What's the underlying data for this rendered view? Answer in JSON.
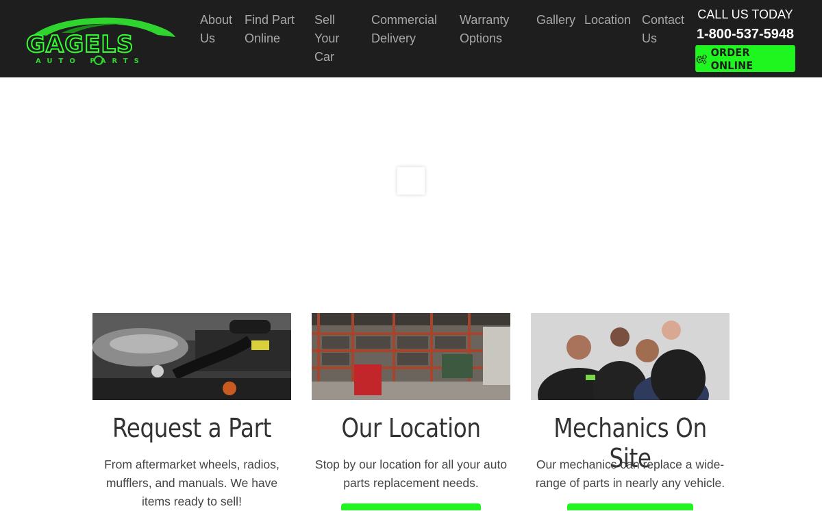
{
  "brand": {
    "logo_word": "GAGELS",
    "logo_sub": "AUTO PARTS",
    "accent": "#1ff61f",
    "header_bg": "#1e1e1e"
  },
  "nav": {
    "items": [
      {
        "label_lines": [
          "About",
          "Us"
        ]
      },
      {
        "label_lines": [
          "Find Part",
          "Online"
        ]
      },
      {
        "label_lines": [
          "Sell",
          "Your",
          "Car"
        ]
      },
      {
        "label_lines": [
          "Commercial",
          "Delivery"
        ]
      },
      {
        "label_lines": [
          "Warranty",
          "Options"
        ]
      },
      {
        "label_lines": [
          "Gallery"
        ]
      },
      {
        "label_lines": [
          "Location"
        ]
      },
      {
        "label_lines": [
          "Contact",
          "Us"
        ]
      }
    ]
  },
  "contact": {
    "call_label": "CALL US TODAY",
    "phone": "1-800-537-5948",
    "order_label": "ORDER ONLINE",
    "order_icon": "gears-icon"
  },
  "cards": [
    {
      "title": "Request a Part",
      "text": "From aftermarket wheels, radios, mufflers, and manuals. We have items ready to sell!",
      "image": "engine-bay-photo"
    },
    {
      "title": "Our Location",
      "text": "Stop by our location for all your auto parts replacement needs.",
      "image": "warehouse-photo"
    },
    {
      "title": "Mechanics On Site",
      "text": "Our mechanics can replace a wide-range of parts in nearly any vehicle.",
      "image": "mechanics-team-photo"
    }
  ]
}
